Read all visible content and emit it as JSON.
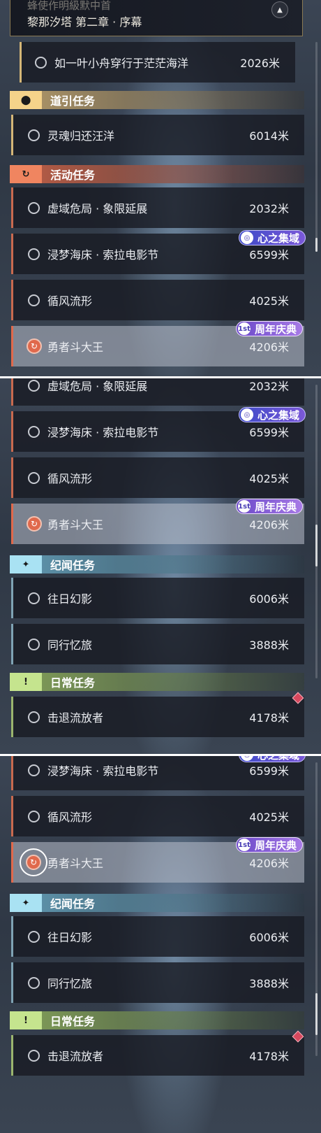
{
  "header": {
    "subtitle": "蜂使作明級默中首",
    "title": "黎那汐塔 第二章 · 序幕",
    "collapse_icon": "chevron-up-icon"
  },
  "main_quest": {
    "name": "如一叶小舟穿行于茫茫海洋",
    "distance": "2026米"
  },
  "categories": {
    "guide": {
      "label": "道引任务",
      "icon": "location-pin-icon"
    },
    "activity": {
      "label": "活动任务",
      "icon": "refresh-quest-icon"
    },
    "story": {
      "label": "纪闻任务",
      "icon": "sparkle-icon"
    },
    "daily": {
      "label": "日常任务",
      "icon": "exclamation-box-icon"
    }
  },
  "quests": {
    "soul": {
      "name": "灵魂归还汪洋",
      "distance": "6014米"
    },
    "void": {
      "name": "虚域危局 · 象限延展",
      "distance": "2032米"
    },
    "dream": {
      "name": "浸梦海床 · 索拉电影节",
      "distance": "6599米"
    },
    "wind": {
      "name": "循风流形",
      "distance": "4025米"
    },
    "brave": {
      "name": "勇者斗大王",
      "distance": "4206米"
    },
    "past": {
      "name": "往日幻影",
      "distance": "6006米"
    },
    "together": {
      "name": "同行忆旅",
      "distance": "3888米"
    },
    "exile": {
      "name": "击退流放者",
      "distance": "4178米"
    }
  },
  "badges": {
    "heart": "心之集域",
    "anniversary": "周年庆典",
    "anniversary_mark": "1st"
  },
  "colors": {
    "guide": "#f5d38a",
    "activity": "#f08560",
    "story": "#a9e2f3",
    "daily": "#c5e48e",
    "selected_row": "#b9c0cc",
    "alert_diamond": "#d7485e"
  },
  "scroll_positions": [
    0.15,
    0.55,
    0.9
  ]
}
